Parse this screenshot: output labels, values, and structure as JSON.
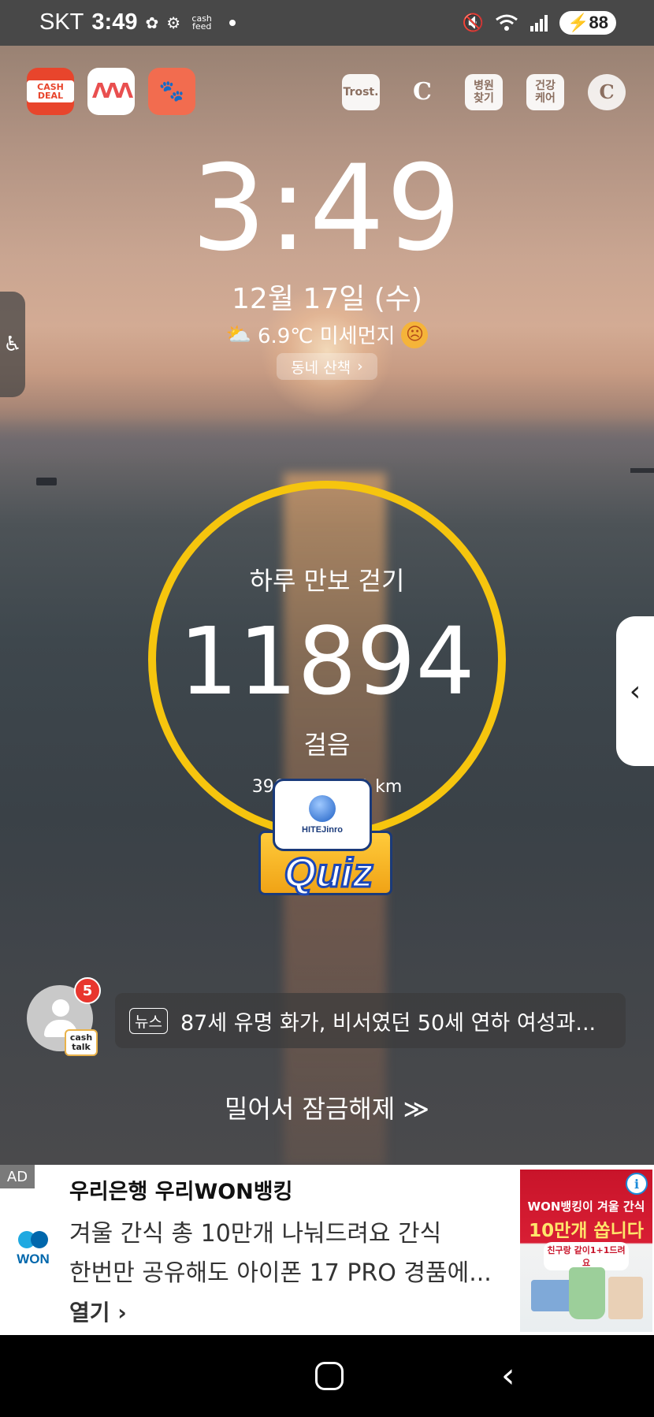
{
  "status_bar": {
    "carrier": "SKT",
    "time": "3:49",
    "cashfeed_label": "cash feed",
    "battery": "88",
    "icons": [
      "mute-icon",
      "wifi-icon",
      "signal-icon",
      "battery-icon"
    ]
  },
  "app_shortcuts": {
    "left": [
      {
        "name": "CASH DEAL",
        "icon": "cashdeal-icon"
      },
      {
        "name": "mm-app",
        "icon": "wave-icon"
      },
      {
        "name": "paw-app",
        "icon": "paw-icon"
      }
    ],
    "right": [
      {
        "label": "Trost.",
        "icon": "trost-icon"
      },
      {
        "label": "C",
        "icon": "cashwalk-bell-icon"
      },
      {
        "label": "병원\n찾기",
        "icon": "hospital-icon"
      },
      {
        "label": "건강\n케어",
        "icon": "health-icon"
      },
      {
        "label": "C",
        "icon": "coin-icon"
      }
    ]
  },
  "lockscreen": {
    "clock": "3:49",
    "date": "12월 17일 (수)",
    "weather": "6.9℃ 미세먼지",
    "walk_chip": "동네 산책"
  },
  "pedometer": {
    "title": "하루 만보 걷기",
    "steps": "11894",
    "unit": "걸음",
    "sub": "396 kcal · 7.1 km",
    "progress_fraction": 1.0,
    "ring_color": "#f6c50e"
  },
  "quiz": {
    "brand": "HITEJinro",
    "label": "Quiz"
  },
  "news": {
    "badge_count": "5",
    "cashtalk": "cash talk",
    "tag": "뉴스",
    "headline": "87세 유명 화가, 비서였던 50세 연하 여성과..."
  },
  "unlock_hint": "밀어서 잠금해제 ≫",
  "ad": {
    "tag": "AD",
    "advertiser": "우리은행 우리WON뱅킹",
    "line1": "겨울 간식 총 10만개 나눠드려요 간식",
    "line2": "한번만 공유해도 아이폰 17 PRO 경품에...",
    "cta": "열기 ›",
    "logo_text": "WON",
    "image_text1": "WON뱅킹이 겨울 간식",
    "image_text2": "10만개 쏩니다",
    "image_text3": "친구랑 같이1+1드려요",
    "info": "i"
  },
  "colors": {
    "accent_yellow": "#f6c50e",
    "badge_red": "#e8362e",
    "won_blue": "#0067ac"
  }
}
